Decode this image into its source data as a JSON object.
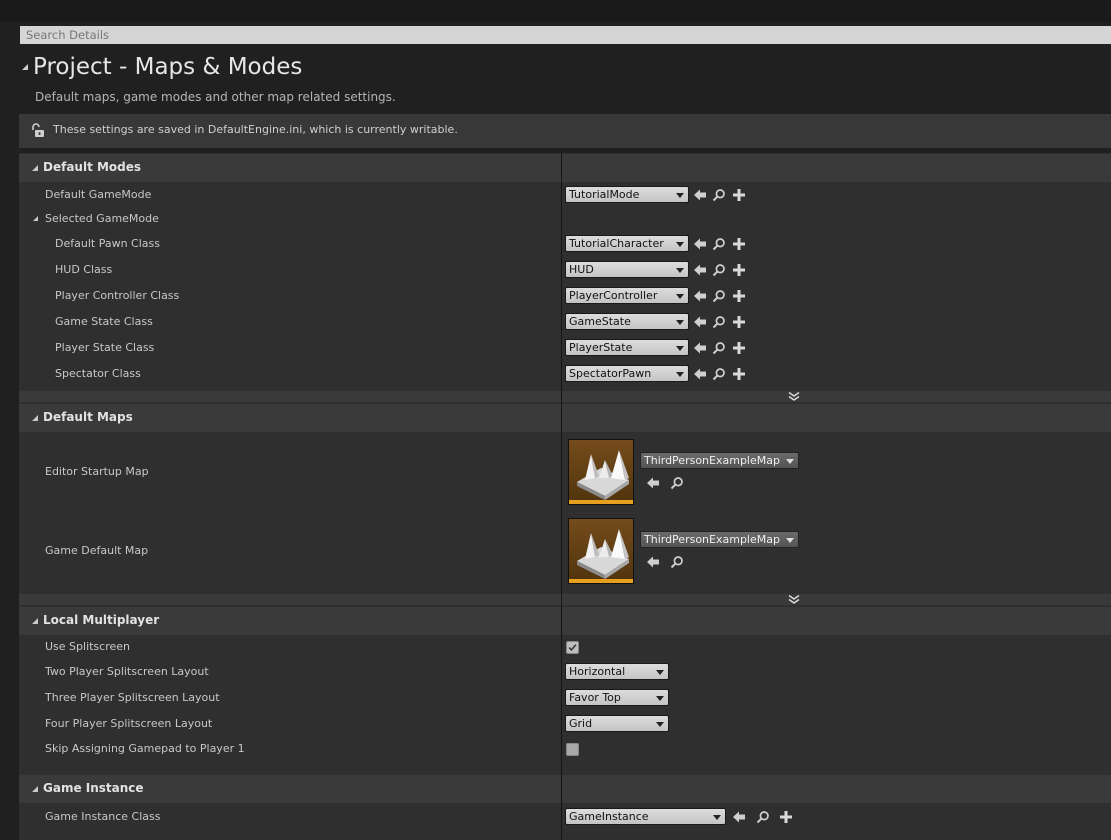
{
  "search": {
    "placeholder": "Search Details"
  },
  "header": {
    "title": "Project - Maps & Modes",
    "description": "Default maps, game modes and other map related settings."
  },
  "notice": {
    "text": "These settings are saved in DefaultEngine.ini, which is currently writable."
  },
  "sections": {
    "default_modes": {
      "label": "Default Modes",
      "default_gamemode": {
        "label": "Default GameMode",
        "value": "TutorialMode"
      },
      "selected_gamemode": {
        "label": "Selected GameMode",
        "default_pawn_class": {
          "label": "Default Pawn Class",
          "value": "TutorialCharacter"
        },
        "hud_class": {
          "label": "HUD Class",
          "value": "HUD"
        },
        "player_controller_class": {
          "label": "Player Controller Class",
          "value": "PlayerController"
        },
        "game_state_class": {
          "label": "Game State Class",
          "value": "GameState"
        },
        "player_state_class": {
          "label": "Player State Class",
          "value": "PlayerState"
        },
        "spectator_class": {
          "label": "Spectator Class",
          "value": "SpectatorPawn"
        }
      }
    },
    "default_maps": {
      "label": "Default Maps",
      "editor_startup_map": {
        "label": "Editor Startup Map",
        "value": "ThirdPersonExampleMap"
      },
      "game_default_map": {
        "label": "Game Default Map",
        "value": "ThirdPersonExampleMap"
      }
    },
    "local_multiplayer": {
      "label": "Local Multiplayer",
      "use_splitscreen": {
        "label": "Use Splitscreen",
        "checked": true
      },
      "two_player_layout": {
        "label": "Two Player Splitscreen Layout",
        "value": "Horizontal"
      },
      "three_player_layout": {
        "label": "Three Player Splitscreen Layout",
        "value": "Favor Top"
      },
      "four_player_layout": {
        "label": "Four Player Splitscreen Layout",
        "value": "Grid"
      },
      "skip_gamepad": {
        "label": "Skip Assigning Gamepad to Player 1",
        "checked": false
      }
    },
    "game_instance": {
      "label": "Game Instance",
      "game_instance_class": {
        "label": "Game Instance Class",
        "value": "GameInstance"
      }
    }
  },
  "icons": {
    "back_arrow": "arrow-left-icon",
    "browse": "magnifier-icon",
    "create": "plus-icon",
    "lock": "unlock-icon",
    "expand": "double-chevron-down-icon",
    "map_thumb": "map-thumbnail-icon"
  },
  "colors": {
    "background": "#202020",
    "panel": "#2f2f2f",
    "category": "#3a3a3a",
    "thumb_accent": "#e8a020"
  }
}
